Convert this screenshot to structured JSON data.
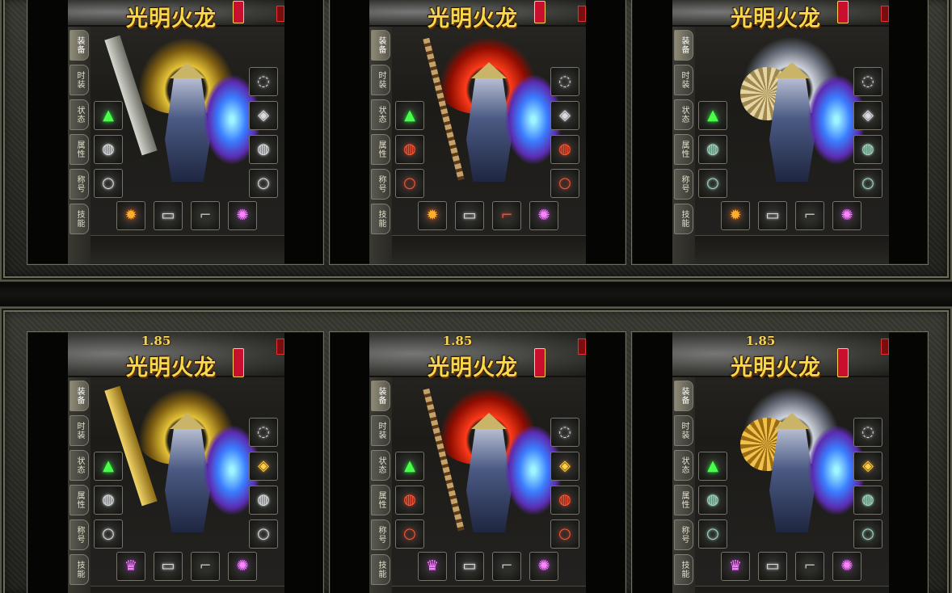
{
  "game": {
    "title": "光明火龙",
    "seal": "光明火龙"
  },
  "side_tabs": [
    "装备",
    "时装",
    "状态",
    "属性",
    "称号",
    "技能"
  ],
  "rows": [
    {
      "version": "",
      "panels": [
        {
          "weapon": "sword",
          "halo": "gold"
        },
        {
          "weapon": "staff",
          "halo": "red"
        },
        {
          "weapon": "fan",
          "halo": "silver"
        }
      ]
    },
    {
      "version": "1.85",
      "panels": [
        {
          "weapon": "sword-gold",
          "halo": "gold"
        },
        {
          "weapon": "staff",
          "halo": "red"
        },
        {
          "weapon": "fan-gold",
          "halo": "silver"
        }
      ]
    }
  ],
  "icons": {
    "necklace": "necklace-icon",
    "medal": "medal-icon",
    "ornament": "green-gem-icon",
    "bracelet": "bracelet-icon",
    "ring": "ring-icon",
    "belt": "belt-icon",
    "boots": "boots-icon",
    "orb": "orb-icon",
    "fire": "fire-charm-icon"
  },
  "colors": {
    "title_gold": "#f7d84a",
    "frame": "#3a3a33",
    "cell_border": "#6e6e62"
  }
}
